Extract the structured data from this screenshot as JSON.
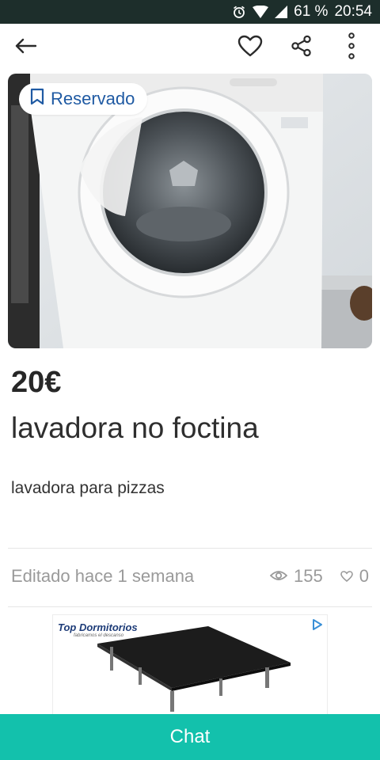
{
  "status_bar": {
    "battery": "61 %",
    "time": "20:54",
    "icons": [
      "alarm-icon",
      "wifi-icon",
      "signal-icon"
    ]
  },
  "app_bar": {
    "icons": [
      "back-arrow-icon",
      "heart-icon",
      "share-icon",
      "more-vert-icon"
    ]
  },
  "listing": {
    "reserved_label": "Reservado",
    "price": "20€",
    "title": "lavadora no foctina",
    "description": "lavadora para pizzas",
    "edited": "Editado hace 1 semana",
    "views": "155",
    "favorites": "0"
  },
  "ad": {
    "brand": "Top Dormitorios",
    "tagline": "fabricamos el descanso"
  },
  "chat": {
    "label": "Chat"
  },
  "colors": {
    "accent": "#13c1ac",
    "reserved_text": "#1f5aa3",
    "status_bar": "#1d2e2b"
  }
}
